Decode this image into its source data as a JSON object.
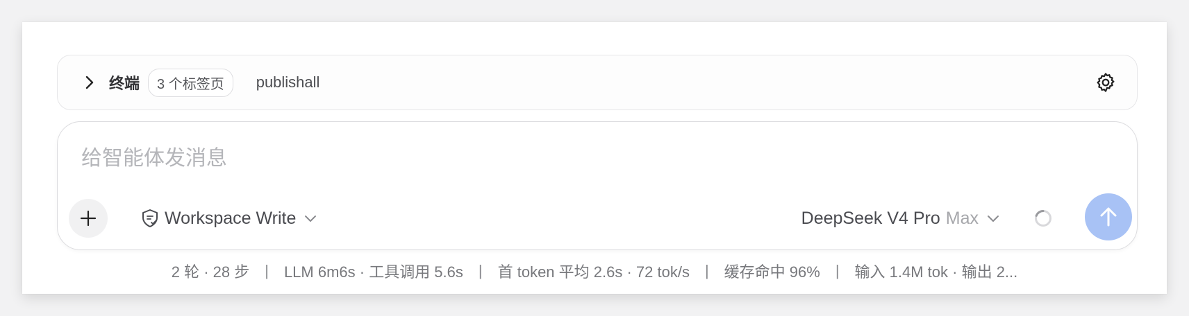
{
  "terminal": {
    "title": "终端",
    "tab_count": "3 个标签页",
    "active_tab": "publishall"
  },
  "composer": {
    "placeholder": "给智能体发消息",
    "permission_mode": "Workspace Write",
    "model_name": "DeepSeek V4 Pro",
    "model_level": "Max"
  },
  "stats": {
    "turns": "2 轮 · 28 步",
    "timing": "LLM 6m6s · 工具调用 5.6s",
    "first_token": "首 token 平均 2.6s · 72 tok/s",
    "cache": "缓存命中 96%",
    "tokens": "输入 1.4M tok · 输出 2...",
    "separator": "|"
  },
  "icons": {
    "terminal_toggle": "chevron-right-icon",
    "terminal_settings": "gear-icon",
    "add": "plus-icon",
    "permission": "shield-icon",
    "dropdown": "chevron-down-icon",
    "loading": "spinner-icon",
    "send": "arrow-up-icon"
  },
  "colors": {
    "send_button": "#a8c2f5",
    "placeholder": "#b4b5b9",
    "text_primary": "#4a4b50",
    "text_muted": "#77787c"
  }
}
